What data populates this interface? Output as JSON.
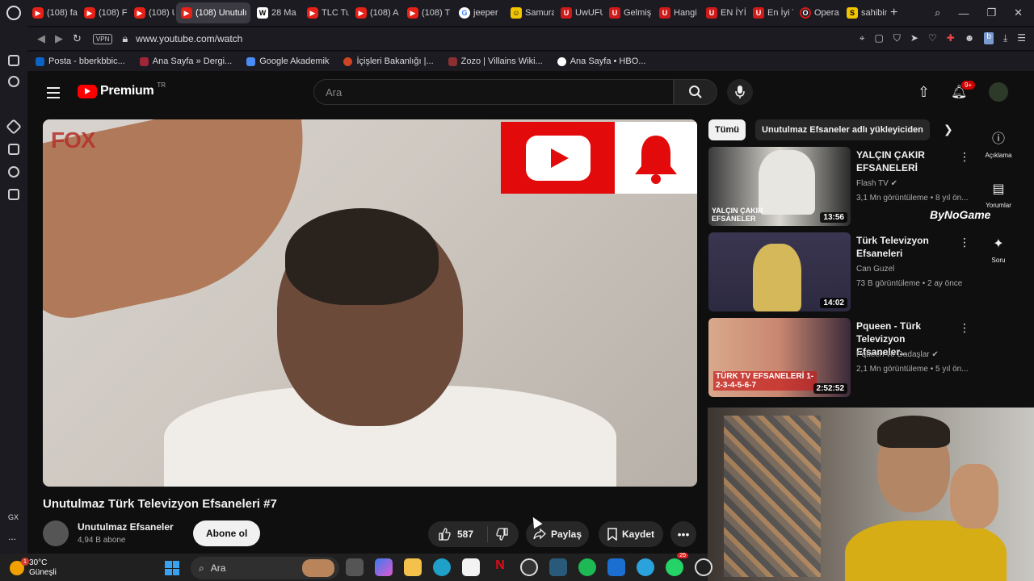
{
  "browser": {
    "tabs": [
      {
        "label": "(108) fa",
        "icon": "youtube"
      },
      {
        "label": "(108) Fi",
        "icon": "youtube"
      },
      {
        "label": "(108) U",
        "icon": "youtube"
      },
      {
        "label": "(108) Unutulı",
        "icon": "youtube",
        "active": true
      },
      {
        "label": "28 Ma",
        "icon": "wikipedia"
      },
      {
        "label": "TLC Tu",
        "icon": "youtube"
      },
      {
        "label": "(108) A",
        "icon": "youtube"
      },
      {
        "label": "(108) T",
        "icon": "youtube"
      },
      {
        "label": "jeeper",
        "icon": "google"
      },
      {
        "label": "Samura",
        "icon": "emoji"
      },
      {
        "label": "UwUFU",
        "icon": "u"
      },
      {
        "label": "Gelmiş",
        "icon": "u"
      },
      {
        "label": "Hangi",
        "icon": "u"
      },
      {
        "label": "EN İYİ",
        "icon": "u"
      },
      {
        "label": "En İyi T",
        "icon": "u"
      },
      {
        "label": "Opera",
        "icon": "opera"
      },
      {
        "label": "sahibin",
        "icon": "s"
      }
    ],
    "url": "www.youtube.com/watch",
    "vpn_label": "VPN",
    "bookmarks": [
      "Posta - bberkbbic...",
      "Ana Sayfa » Dergi...",
      "Google Akademik",
      "İçişleri Bakanlığı |...",
      "Zozo | Villains Wiki...",
      "Ana Sayfa • HBO..."
    ],
    "sidebar_gx": "GX",
    "sidebar_more": "..."
  },
  "youtube": {
    "logo_text": "Premium",
    "logo_region": "TR",
    "search_placeholder": "Ara",
    "notif_badge": "9+",
    "player": {
      "channel_logo": "FOX"
    },
    "video": {
      "title": "Unutulmaz Türk Televizyon Efsaneleri #7",
      "channel": "Unutulmaz Efsaneler",
      "subscribers": "4,94 B abone",
      "subscribe_label": "Abone ol",
      "likes": "587",
      "share_label": "Paylaş",
      "save_label": "Kaydet"
    },
    "chips": {
      "all": "Tümü",
      "uploader": "Unutulmaz Efsaneler adlı yükleyiciden"
    },
    "recommendations": [
      {
        "title": "YALÇIN ÇAKIR EFSANELERİ",
        "channel": "Flash TV",
        "verified": true,
        "meta": "3,1 Mn görüntüleme • 8 yıl ön...",
        "duration": "13:56",
        "thumb_caption": "YALÇIN ÇAKIR EFSANELER"
      },
      {
        "title": "Türk Televizyon Efsaneleri",
        "channel": "Can Guzel",
        "verified": false,
        "meta": "73 B görüntüleme • 2 ay önce",
        "duration": "14:02",
        "thumb_caption": ""
      },
      {
        "title": "Pqueen - Türk Televizyon Efsaneler...",
        "channel": "Pqueen ve Dadaşlar",
        "verified": true,
        "meta": "2,1 Mn görüntüleme • 5 yıl ön...",
        "duration": "2:52:52",
        "thumb_caption": "TÜRK TV EFSANELERİ 1-2-3-4-5-6-7"
      }
    ],
    "rail": {
      "description": "Açıklama",
      "comments": "Yorumlar",
      "ask": "Soru"
    },
    "overlay_brand": "ByNoGame"
  },
  "taskbar": {
    "temperature": "30°C",
    "weather": "Güneşli",
    "weather_badge": "1",
    "search_placeholder": "Ara",
    "whatsapp_badge": "25"
  }
}
